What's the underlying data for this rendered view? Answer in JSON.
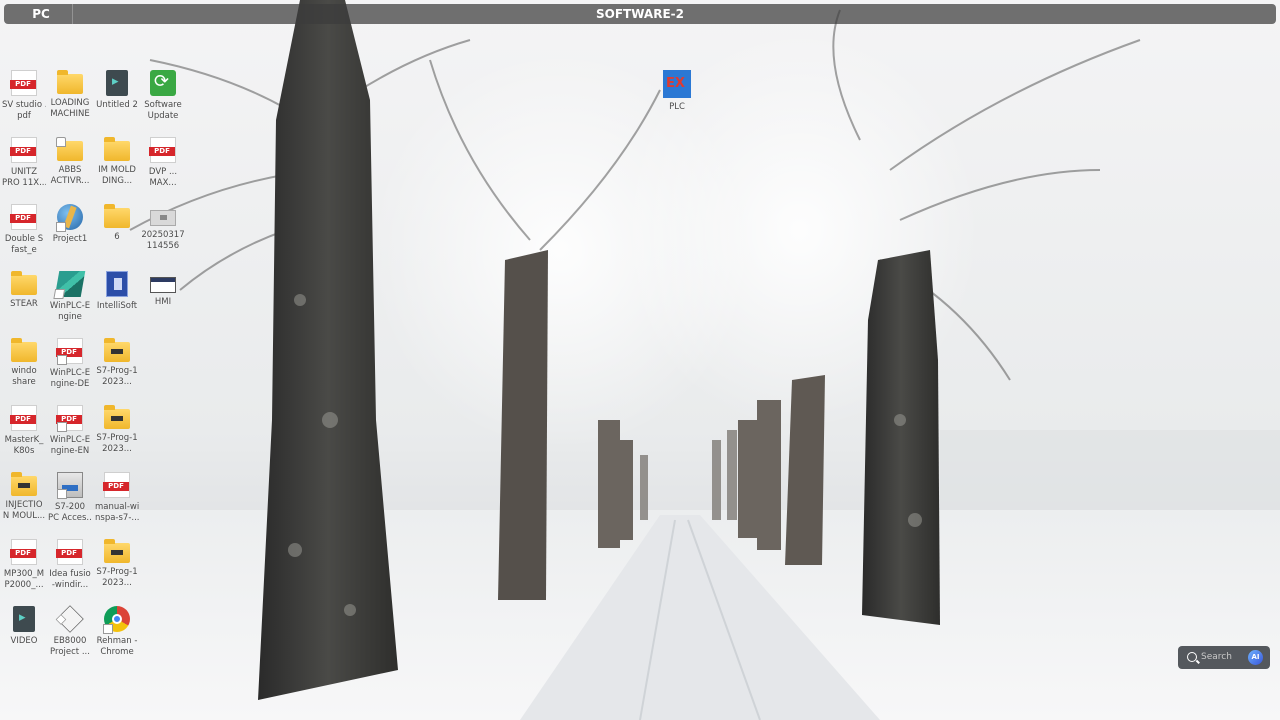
{
  "session": {
    "left_label": "PC",
    "title": "SOFTWARE-2"
  },
  "taskbar_search": {
    "placeholder": "Search",
    "ai_label": "AI"
  },
  "desktop_icons": [
    {
      "id": "sv-studio",
      "glyph": "pdf-icon",
      "lines": [
        "SV studio ...",
        "pdf"
      ]
    },
    {
      "id": "loading-machine",
      "glyph": "folder-icon",
      "lines": [
        "LOADING",
        "MACHINE"
      ]
    },
    {
      "id": "untitled-2",
      "glyph": "video-file-icon",
      "lines": [
        "Untitled 2",
        ""
      ]
    },
    {
      "id": "software-update",
      "glyph": "update-icon",
      "lines": [
        "Software",
        "Update"
      ]
    },
    {
      "id": "unitz-pro",
      "glyph": "pdf-icon",
      "lines": [
        "UNITZ",
        "PRO 11X..."
      ]
    },
    {
      "id": "abbs-activ",
      "glyph": "folder-icon",
      "lines": [
        "ABBS",
        "ACTIVR..."
      ]
    },
    {
      "id": "im-mold",
      "glyph": "folder-icon",
      "lines": [
        "IM MOLD",
        "DING..."
      ]
    },
    {
      "id": "pdf-4",
      "glyph": "pdf-icon",
      "lines": [
        "DVP ...",
        "MAX..."
      ]
    },
    {
      "id": "double-s",
      "glyph": "pdf-icon",
      "lines": [
        "Double S",
        "fast_e"
      ]
    },
    {
      "id": "project1",
      "glyph": "globe-icon",
      "lines": [
        "Project1",
        ""
      ]
    },
    {
      "id": "folder-6",
      "glyph": "folder-icon",
      "lines": [
        "6",
        ""
      ]
    },
    {
      "id": "drive-2025",
      "glyph": "drive-icon",
      "lines": [
        "20250317",
        "114556"
      ]
    },
    {
      "id": "steer",
      "glyph": "folder-icon",
      "lines": [
        "STEAR",
        ""
      ]
    },
    {
      "id": "winplc-engine",
      "glyph": "winplc-icon",
      "lines": [
        "WinPLC-E",
        "ngine"
      ]
    },
    {
      "id": "intellisoft",
      "glyph": "app-icon",
      "lines": [
        "IntelliSoft",
        ""
      ]
    },
    {
      "id": "hmi",
      "glyph": "window-icon",
      "lines": [
        "HMI",
        ""
      ]
    },
    {
      "id": "window-share",
      "glyph": "folder-icon",
      "lines": [
        "windo",
        "share"
      ]
    },
    {
      "id": "winplc-de",
      "glyph": "pdf-icon",
      "lines": [
        "WinPLC-E",
        "ngine-DE"
      ]
    },
    {
      "id": "s7-prog-1",
      "glyph": "folder-icon",
      "lines": [
        "S7-Prog-1",
        "2023..."
      ]
    },
    {
      "id": "master-k80s",
      "glyph": "pdf-icon",
      "lines": [
        "MasterK_",
        "K80s"
      ]
    },
    {
      "id": "winplc-en",
      "glyph": "pdf-icon",
      "lines": [
        "WinPLC-E",
        "ngine-EN"
      ]
    },
    {
      "id": "s7-prog-2",
      "glyph": "folder-icon",
      "lines": [
        "S7-Prog-1",
        "2023..."
      ]
    },
    {
      "id": "injection-mould",
      "glyph": "folder-icon",
      "lines": [
        "INJECTIO",
        "N MOUL..."
      ]
    },
    {
      "id": "s7-200",
      "glyph": "tool-icon",
      "lines": [
        "S7-200",
        "PC Acces..."
      ]
    },
    {
      "id": "manual",
      "glyph": "pdf-icon",
      "lines": [
        "manual-wi",
        "nspa-s7-..."
      ]
    },
    {
      "id": "mp300",
      "glyph": "pdf-icon",
      "lines": [
        "MP300_M",
        "P2000_..."
      ]
    },
    {
      "id": "idea-fusion",
      "glyph": "pdf-icon",
      "lines": [
        "Idea fusio",
        "-windir..."
      ]
    },
    {
      "id": "s7-prog-3",
      "glyph": "folder-icon",
      "lines": [
        "S7-Prog-1",
        "2023..."
      ]
    },
    {
      "id": "video",
      "glyph": "video-file-icon",
      "lines": [
        "VIDEO",
        ""
      ]
    },
    {
      "id": "eb8000",
      "glyph": "shape-icon",
      "lines": [
        "EB8000",
        "Project ..."
      ]
    },
    {
      "id": "chrome",
      "glyph": "chrome-icon",
      "lines": [
        "Rehman -",
        "Chrome"
      ]
    },
    {
      "id": "plc",
      "glyph": "plc-icon",
      "lines": [
        "PLC",
        ""
      ]
    }
  ]
}
